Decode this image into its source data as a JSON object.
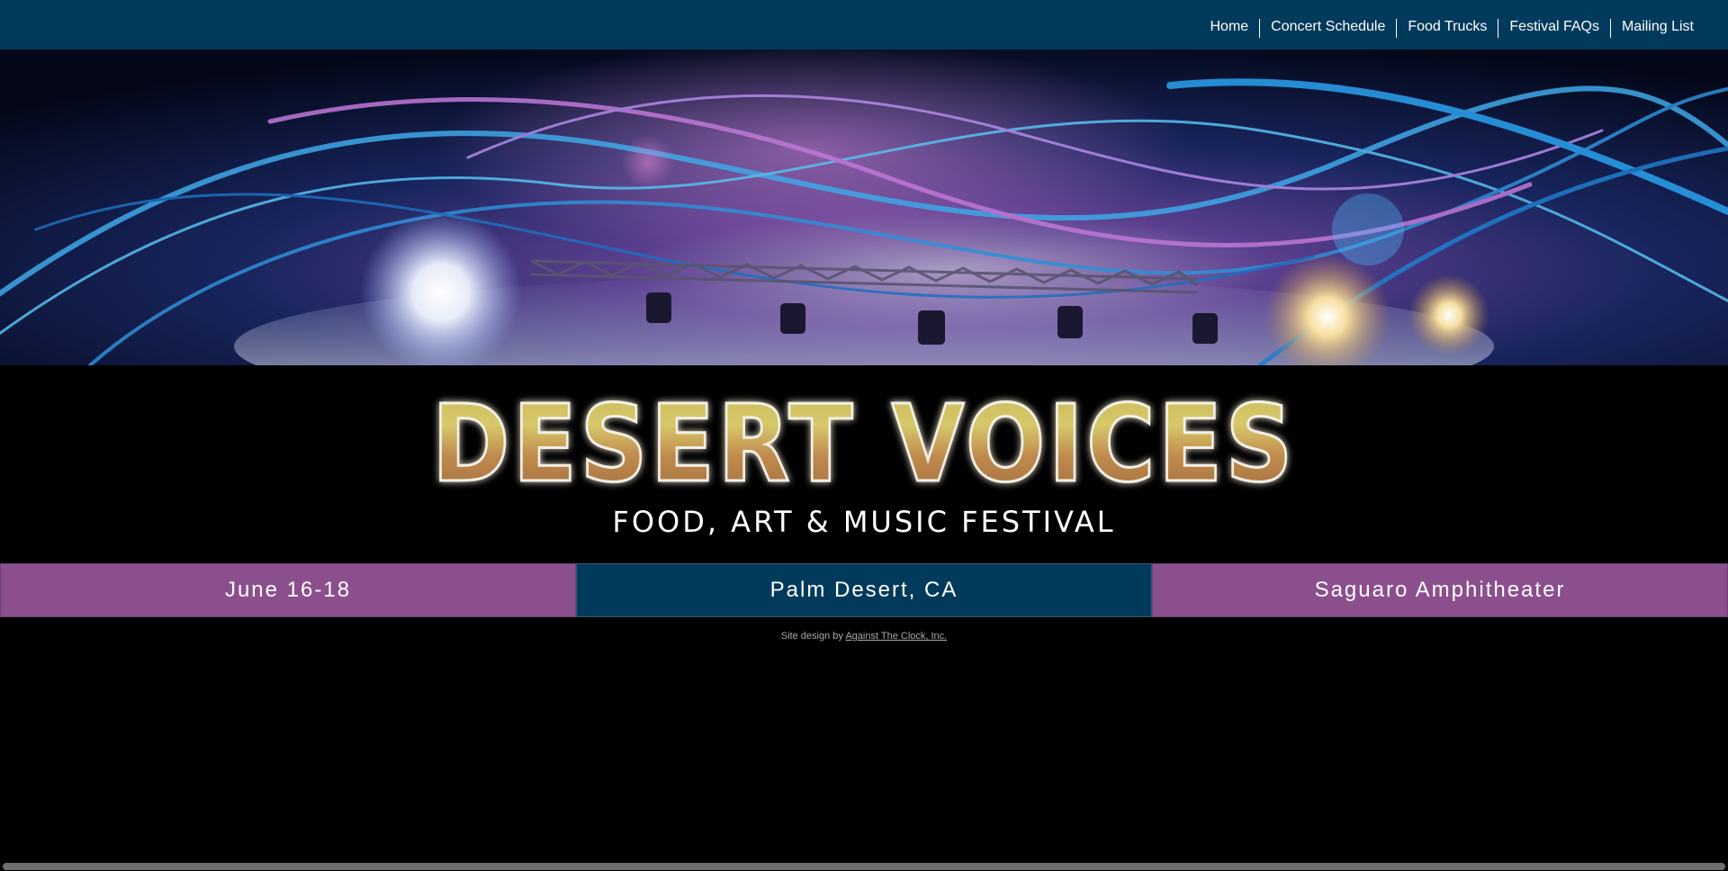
{
  "nav": {
    "items": [
      {
        "label": "Home"
      },
      {
        "label": "Concert Schedule"
      },
      {
        "label": "Food Trucks"
      },
      {
        "label": "Festival FAQs"
      },
      {
        "label": "Mailing List"
      }
    ]
  },
  "logo": {
    "title": "DESERT VOICES",
    "subtitle": "FOOD, ART & MUSIC FESTIVAL"
  },
  "info": {
    "dates": "June 16-18",
    "location": "Palm Desert, CA",
    "venue": "Saguaro Amphitheater"
  },
  "footer": {
    "prefix": "Site design by",
    "link": "Against The Clock, Inc."
  },
  "colors": {
    "nav_bg": "#023a5b",
    "purple": "#8b4f8e",
    "blue": "#023a5b"
  }
}
